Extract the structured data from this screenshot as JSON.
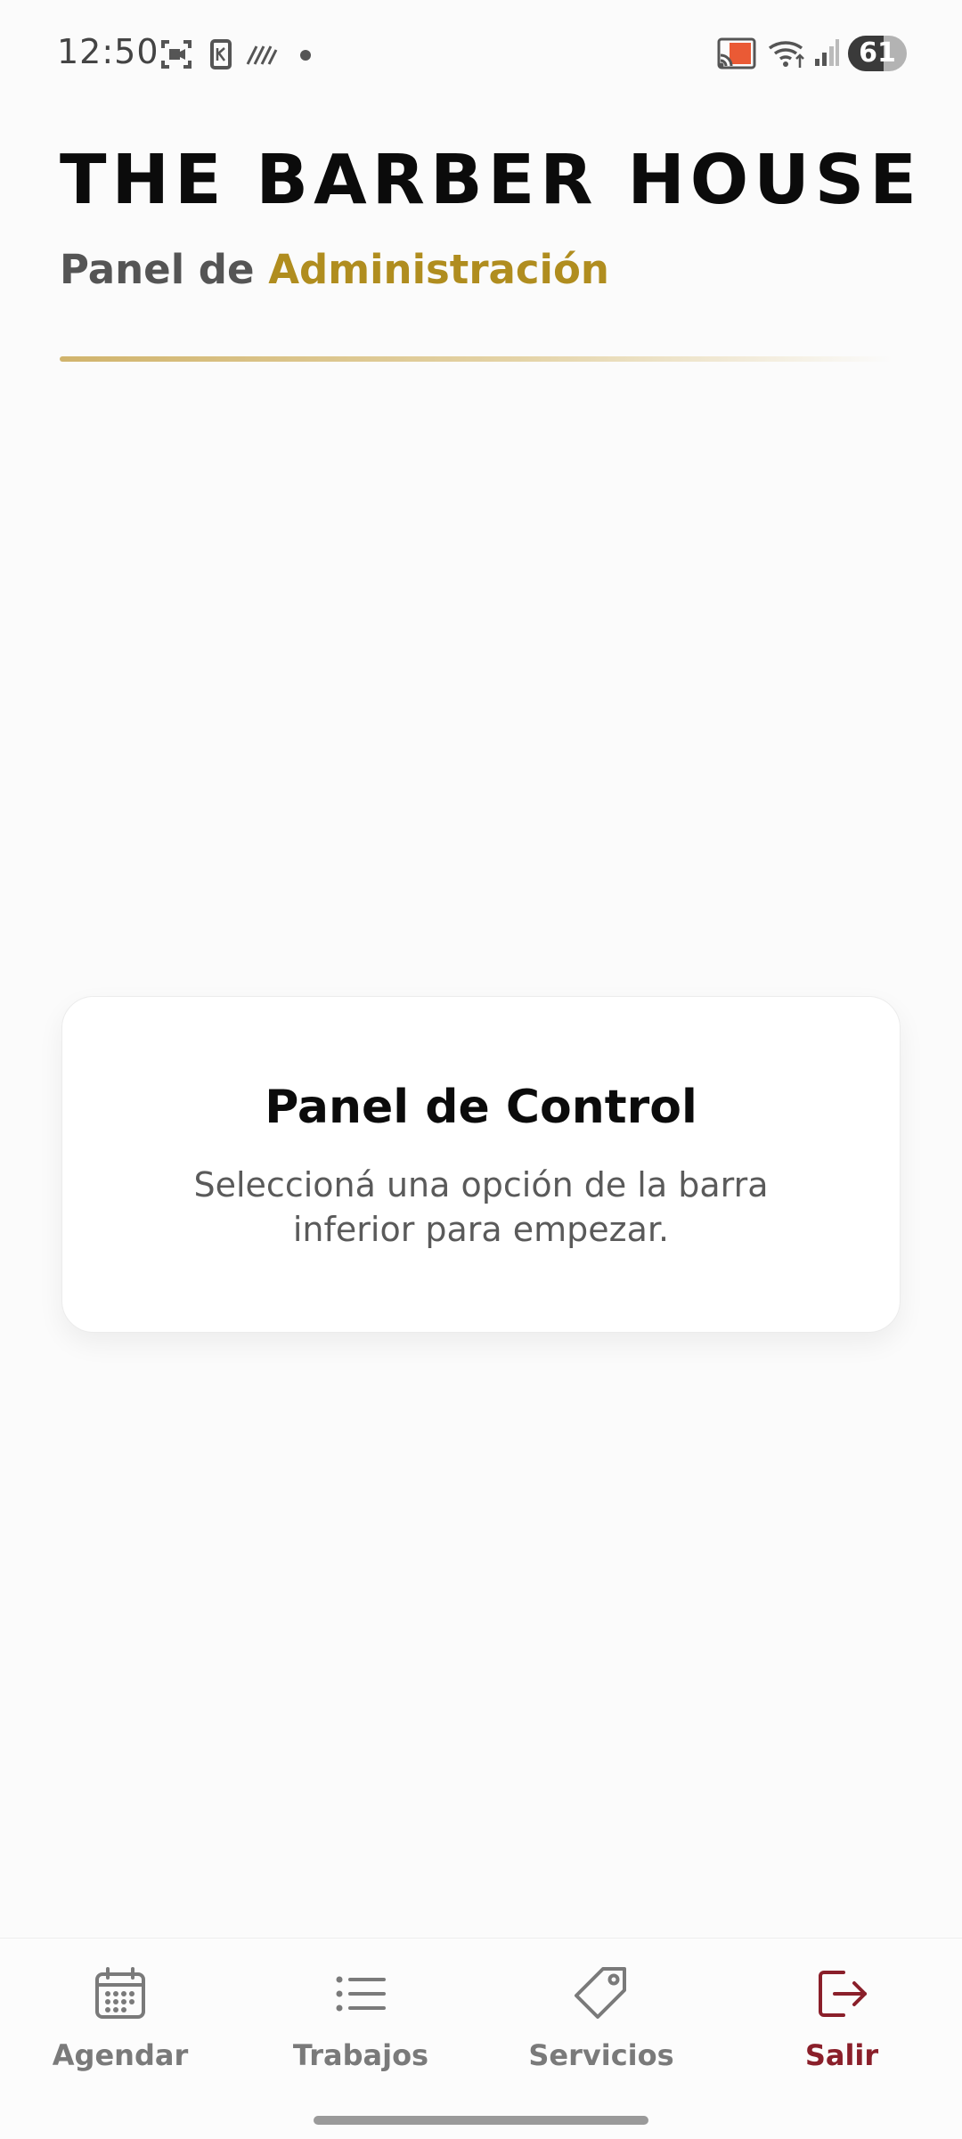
{
  "status_bar": {
    "time": "12:50",
    "battery_level": "61",
    "battery_fraction": 0.61,
    "left_icons": [
      "screen-record-icon",
      "k-app-icon",
      "hatched-icon",
      "notification-dot-icon"
    ],
    "right_icons": [
      "cast-icon",
      "wifi-icon",
      "signal-icon",
      "battery-icon"
    ]
  },
  "header": {
    "title": "THE BARBER HOUSE",
    "subtitle_prefix": "Panel de",
    "subtitle_highlight": "Administración"
  },
  "card": {
    "title": "Panel de Control",
    "body": "Seleccioná una opción de la barra inferior para empezar."
  },
  "bottom_nav": {
    "items": [
      {
        "label": "Agendar",
        "icon": "calendar-icon",
        "active": false
      },
      {
        "label": "Trabajos",
        "icon": "list-icon",
        "active": false
      },
      {
        "label": "Servicios",
        "icon": "tag-icon",
        "active": false
      },
      {
        "label": "Salir",
        "icon": "logout-icon",
        "active": true
      }
    ]
  },
  "colors": {
    "background": "#fbfbfb",
    "accent_gold": "#b08d1f",
    "logout_red": "#8a1f2a",
    "nav_gray": "#7a7a7a"
  }
}
